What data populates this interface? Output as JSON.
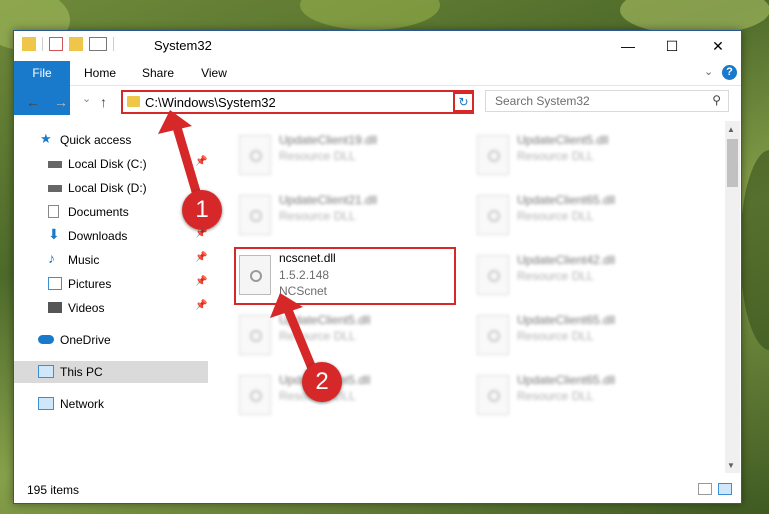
{
  "window": {
    "title": "System32"
  },
  "window_controls": {
    "minimize": "—",
    "maximize": "☐",
    "close": "✕"
  },
  "ribbon": {
    "tabs": [
      "File",
      "Home",
      "Share",
      "View"
    ]
  },
  "nav": {
    "back": "←",
    "forward": "→",
    "recent": "⌄",
    "up": "↑"
  },
  "address": {
    "path": "C:\\Windows\\System32",
    "dropdown": "⌄",
    "refresh": "↻"
  },
  "search": {
    "placeholder": "Search System32",
    "icon": "search-icon"
  },
  "sidebar": {
    "items": [
      {
        "label": "Quick access",
        "icon": "star-icon"
      },
      {
        "label": "Local Disk (C:)",
        "icon": "drive-icon"
      },
      {
        "label": "Local Disk (D:)",
        "icon": "drive-icon"
      },
      {
        "label": "Documents",
        "icon": "documents-icon"
      },
      {
        "label": "Downloads",
        "icon": "download-icon"
      },
      {
        "label": "Music",
        "icon": "music-icon"
      },
      {
        "label": "Pictures",
        "icon": "pictures-icon"
      },
      {
        "label": "Videos",
        "icon": "videos-icon"
      },
      {
        "label": "OneDrive",
        "icon": "cloud-icon"
      },
      {
        "label": "This PC",
        "icon": "computer-icon"
      },
      {
        "label": "Network",
        "icon": "network-icon"
      }
    ],
    "pin_glyph": "📌"
  },
  "files": [
    {
      "name": "UpdateClient19.dll",
      "line2": "Resource DLL",
      "line3": ""
    },
    {
      "name": "UpdateClient5.dll",
      "line2": "Resource DLL",
      "line3": ""
    },
    {
      "name": "UpdateClient21.dll",
      "line2": "Resource DLL",
      "line3": ""
    },
    {
      "name": "UpdateClient65.dll",
      "line2": "Resource DLL",
      "line3": ""
    },
    {
      "name": "ncscnet.dll",
      "line2": "1.5.2.148",
      "line3": "NCScnet"
    },
    {
      "name": "UpdateClient42.dll",
      "line2": "Resource DLL",
      "line3": ""
    },
    {
      "name": "UpdateClient5.dll",
      "line2": "Resource DLL",
      "line3": ""
    },
    {
      "name": "UpdateClient65.dll",
      "line2": "Resource DLL",
      "line3": ""
    },
    {
      "name": "UpdateClient5.dll",
      "line2": "Resource DLL",
      "line3": ""
    },
    {
      "name": "UpdateClient65.dll",
      "line2": "Resource DLL",
      "line3": ""
    }
  ],
  "status": {
    "count": "195 items"
  },
  "annotations": {
    "badge1": "1",
    "badge2": "2"
  },
  "colors": {
    "accent": "#1979ca",
    "highlight": "#d62828"
  }
}
